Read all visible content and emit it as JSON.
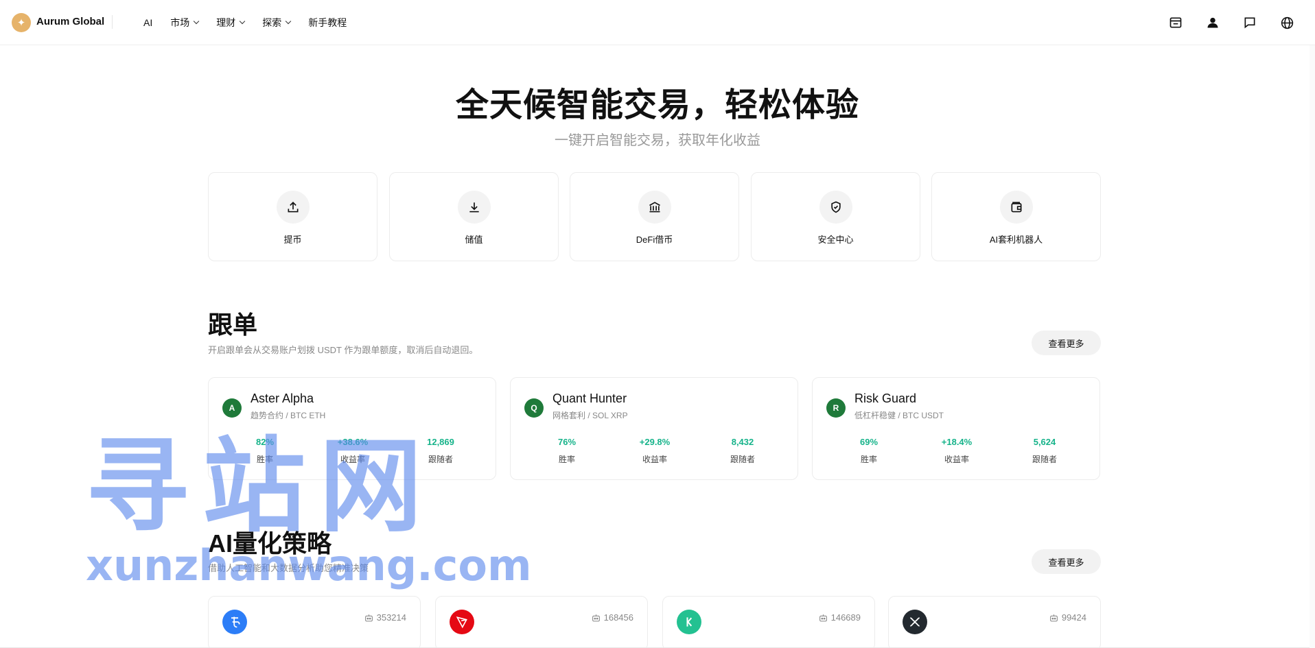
{
  "header": {
    "brand": "Aurum Global",
    "logo_icon": "sparkle-icon",
    "nav": [
      {
        "label": "AI",
        "dropdown": false
      },
      {
        "label": "市场",
        "dropdown": true
      },
      {
        "label": "理财",
        "dropdown": true
      },
      {
        "label": "探索",
        "dropdown": true
      },
      {
        "label": "新手教程",
        "dropdown": false
      }
    ],
    "right_icons": [
      "mailbox-icon",
      "user-icon",
      "chat-icon",
      "globe-icon"
    ]
  },
  "hero": {
    "title": "全天候智能交易，轻松体验",
    "subtitle": "一键开启智能交易，获取年化收益"
  },
  "quick_actions": [
    {
      "label": "提币",
      "icon": "upload-icon"
    },
    {
      "label": "储值",
      "icon": "download-icon"
    },
    {
      "label": "DeFi借币",
      "icon": "bank-icon"
    },
    {
      "label": "安全中心",
      "icon": "shield-check-icon"
    },
    {
      "label": "AI套利机器人",
      "icon": "wallet-icon"
    }
  ],
  "copy_trade": {
    "title": "跟单",
    "description": "开启跟单会从交易账户划拨 USDT 作为跟单额度，取消后自动退回。",
    "more_label": "查看更多",
    "cards": [
      {
        "initial": "A",
        "name": "Aster Alpha",
        "sub": "趋势合约 / BTC ETH",
        "stats": [
          {
            "value": "82%",
            "label": "胜率"
          },
          {
            "value": "+38.6%",
            "label": "收益率"
          },
          {
            "value": "12,869",
            "label": "跟随者"
          }
        ]
      },
      {
        "initial": "Q",
        "name": "Quant Hunter",
        "sub": "网格套利 / SOL XRP",
        "stats": [
          {
            "value": "76%",
            "label": "胜率"
          },
          {
            "value": "+29.8%",
            "label": "收益率"
          },
          {
            "value": "8,432",
            "label": "跟随者"
          }
        ]
      },
      {
        "initial": "R",
        "name": "Risk Guard",
        "sub": "低杠杆稳健 / BTC USDT",
        "stats": [
          {
            "value": "69%",
            "label": "胜率"
          },
          {
            "value": "+18.4%",
            "label": "收益率"
          },
          {
            "value": "5,624",
            "label": "跟随者"
          }
        ]
      }
    ]
  },
  "ai_strategy": {
    "title": "AI量化策略",
    "description": "借助人工智能和大数据分析助您精准决策",
    "more_label": "查看更多",
    "cards": [
      {
        "coin_icon": "tezos-icon",
        "color": "#2c7df7",
        "count": "353214"
      },
      {
        "coin_icon": "tron-icon",
        "color": "#e50914",
        "count": "168456"
      },
      {
        "coin_icon": "kucoin-icon",
        "color": "#23c191",
        "count": "146689"
      },
      {
        "coin_icon": "xrp-icon",
        "color": "#23292f",
        "count": "99424"
      }
    ]
  },
  "watermark": {
    "big": "寻站网",
    "small": "xunzhanwang.com"
  },
  "colors": {
    "positive": "#16b38a",
    "avatar_green": "#1f7a3a",
    "logo_gold": "#e6b36a"
  }
}
